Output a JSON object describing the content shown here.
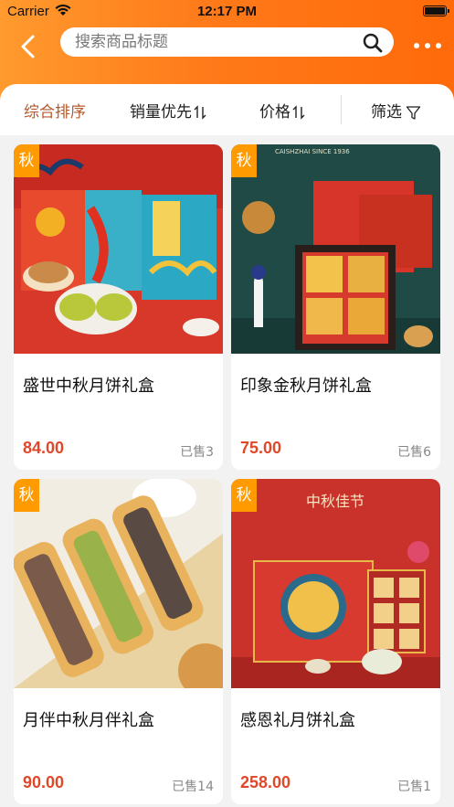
{
  "status_bar": {
    "carrier": "Carrier",
    "time": "12:17 PM"
  },
  "header": {
    "search_placeholder": "搜索商品标题",
    "colors": {
      "gradient_start": "#ff9a2e",
      "gradient_end": "#ff6a0a"
    }
  },
  "sort_bar": {
    "items": [
      {
        "label": "综合排序",
        "active": true
      },
      {
        "label": "销量优先",
        "icon": "sort-arrows-icon"
      },
      {
        "label": "价格",
        "icon": "sort-arrows-icon"
      },
      {
        "label": "筛选",
        "icon": "filter-icon"
      }
    ]
  },
  "products": [
    {
      "tag": "秋",
      "title": "盛世中秋月饼礼盒",
      "price": "84.00",
      "sold": "已售3"
    },
    {
      "tag": "秋",
      "title": "印象金秋月饼礼盒",
      "price": "75.00",
      "sold": "已售6"
    },
    {
      "tag": "秋",
      "title": "月伴中秋月伴礼盒",
      "price": "90.00",
      "sold": "已售14"
    },
    {
      "tag": "秋",
      "title": "感恩礼月饼礼盒",
      "price": "258.00",
      "sold": "已售1"
    }
  ],
  "image_text": {
    "p2_brand": "CAISHZHAI SINCE 1936",
    "p4_banner": "中秋佳节"
  },
  "colors": {
    "accent": "#b65a2c",
    "price": "#e0482a",
    "tag": "#ff9a00"
  }
}
